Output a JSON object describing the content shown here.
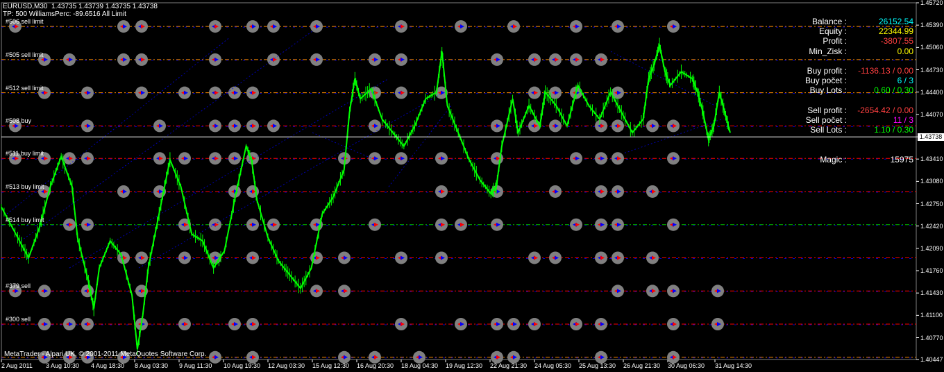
{
  "header": {
    "line1": "EURUSD,M30  1.43735 1.43739 1.43735 1.43738",
    "line2": "TP: 500 WilliamsPerc: -89.6516 All Limit"
  },
  "footer": {
    "copyright": "MetaTrader - Alpari UK, © 2001-2011 MetaQuotes Software Corp."
  },
  "colors": {
    "background": "#000000",
    "price_line": "#00ff00",
    "buy_level": "#ff0000",
    "sell_level": "#0000ff",
    "alt_level": "#ff8c00",
    "green_level": "#00c000",
    "marker": "#808080",
    "label": "#ffffff",
    "value_cyan": "#00ffff",
    "value_yellow": "#ffff00",
    "value_red": "#ff4040",
    "value_magenta": "#ff00ff",
    "value_green": "#00ff00"
  },
  "panel": [
    {
      "label": "Balance :",
      "value": "26152.54",
      "color": "#00ffff"
    },
    {
      "label": "Equity :",
      "value": "22344.99",
      "color": "#ffff00"
    },
    {
      "label": "Profit :",
      "value": "-3807.55",
      "color": "#ff4040"
    },
    {
      "label": "Min_Zisk :",
      "value": "0.00",
      "color": "#ffff00"
    },
    {
      "label": "",
      "value": "",
      "color": "#ffffff"
    },
    {
      "label": "Buy profit :",
      "value": "-1136.13 / 0.00",
      "color": "#ff4040"
    },
    {
      "label": "Buy počet :",
      "value": "6 / 3",
      "color": "#00ffff"
    },
    {
      "label": "Buy Lots :",
      "value": "0.60 / 0.30",
      "color": "#00ff00"
    },
    {
      "label": "",
      "value": "",
      "color": "#ffffff"
    },
    {
      "label": "Sell profit :",
      "value": "-2654.42 / 0.00",
      "color": "#ff4040"
    },
    {
      "label": "Sell počet :",
      "value": "11 / 3",
      "color": "#ff00ff"
    },
    {
      "label": "Sell Lots :",
      "value": "1.10 / 0.30",
      "color": "#00ff00"
    },
    {
      "label": "",
      "value": "",
      "color": "#ffffff"
    },
    {
      "label": "",
      "value": "",
      "color": "#ffffff"
    },
    {
      "label": "Magic :",
      "value": "15975",
      "color": "#ffffff"
    }
  ],
  "chart_data": {
    "type": "line",
    "symbol": "EURUSD",
    "timeframe": "M30",
    "current_price": 1.43738,
    "current_price_label": "1.43738",
    "ylim": [
      1.40447,
      1.4572
    ],
    "y_ticks": [
      "1.45720",
      "1.45390",
      "1.45060",
      "1.44730",
      "1.44400",
      "1.44070",
      "1.43738",
      "1.43410",
      "1.43080",
      "1.42750",
      "1.42420",
      "1.42090",
      "1.41760",
      "1.41430",
      "1.41100",
      "1.40770",
      "1.40447"
    ],
    "x_ticks": [
      "2 Aug 2011",
      "3 Aug 10:30",
      "4 Aug 18:30",
      "8 Aug 03:30",
      "9 Aug 11:30",
      "10 Aug 19:30",
      "12 Aug 03:30",
      "15 Aug 12:30",
      "16 Aug 20:30",
      "18 Aug 04:30",
      "19 Aug 12:30",
      "22 Aug 21:30",
      "24 Aug 05:30",
      "25 Aug 13:30",
      "26 Aug 21:30",
      "30 Aug 06:30",
      "31 Aug 14:30"
    ],
    "levels": [
      {
        "label": "#506 sell limit",
        "price": 1.4537,
        "style": "sell"
      },
      {
        "label": "#505 sell limit",
        "price": 1.4488,
        "style": "sell"
      },
      {
        "label": "#512 sell limit",
        "price": 1.4439,
        "style": "sell"
      },
      {
        "label": "#508 buy",
        "price": 1.439,
        "style": "buy"
      },
      {
        "label": "#511 buy limit",
        "price": 1.4342,
        "style": "buy"
      },
      {
        "label": "#513 buy limit",
        "price": 1.4293,
        "style": "buy"
      },
      {
        "label": "#514 buy limit",
        "price": 1.4244,
        "style": "green"
      },
      {
        "label": "",
        "price": 1.4195,
        "style": "buy"
      },
      {
        "label": "#379 sell",
        "price": 1.4146,
        "style": "buy"
      },
      {
        "label": "#300 sell",
        "price": 1.4097,
        "style": "buy"
      },
      {
        "label": "",
        "price": 1.4048,
        "style": "sell"
      }
    ],
    "price_path": [
      [
        0,
        1.427
      ],
      [
        3,
        1.4225
      ],
      [
        5,
        1.4195
      ],
      [
        7,
        1.424
      ],
      [
        9,
        1.43
      ],
      [
        11,
        1.4345
      ],
      [
        13,
        1.43
      ],
      [
        14,
        1.4225
      ],
      [
        16,
        1.416
      ],
      [
        17,
        1.412
      ],
      [
        18,
        1.418
      ],
      [
        20,
        1.422
      ],
      [
        22,
        1.42
      ],
      [
        24,
        1.414
      ],
      [
        25,
        1.406
      ],
      [
        26,
        1.411
      ],
      [
        27,
        1.418
      ],
      [
        29,
        1.426
      ],
      [
        31,
        1.434
      ],
      [
        33,
        1.43
      ],
      [
        35,
        1.423
      ],
      [
        37,
        1.422
      ],
      [
        39,
        1.418
      ],
      [
        41,
        1.4205
      ],
      [
        43,
        1.4285
      ],
      [
        45,
        1.436
      ],
      [
        46,
        1.434
      ],
      [
        47,
        1.428
      ],
      [
        49,
        1.4225
      ],
      [
        51,
        1.419
      ],
      [
        53,
        1.417
      ],
      [
        55,
        1.415
      ],
      [
        57,
        1.418
      ],
      [
        59,
        1.426
      ],
      [
        61,
        1.4285
      ],
      [
        63,
        1.4325
      ],
      [
        64,
        1.441
      ],
      [
        65,
        1.446
      ],
      [
        66,
        1.443
      ],
      [
        68,
        1.4445
      ],
      [
        70,
        1.44
      ],
      [
        72,
        1.438
      ],
      [
        74,
        1.436
      ],
      [
        76,
        1.439
      ],
      [
        78,
        1.443
      ],
      [
        80,
        1.444
      ],
      [
        81,
        1.45
      ],
      [
        82,
        1.442
      ],
      [
        84,
        1.438
      ],
      [
        86,
        1.434
      ],
      [
        88,
        1.431
      ],
      [
        90,
        1.429
      ],
      [
        91,
        1.43
      ],
      [
        92,
        1.436
      ],
      [
        94,
        1.443
      ],
      [
        95,
        1.438
      ],
      [
        97,
        1.442
      ],
      [
        99,
        1.439
      ],
      [
        100,
        1.444
      ],
      [
        102,
        1.442
      ],
      [
        104,
        1.439
      ],
      [
        106,
        1.445
      ],
      [
        108,
        1.442
      ],
      [
        110,
        1.44
      ],
      [
        112,
        1.444
      ],
      [
        114,
        1.441
      ],
      [
        116,
        1.438
      ],
      [
        118,
        1.44
      ],
      [
        119,
        1.446
      ],
      [
        120,
        1.448
      ],
      [
        121,
        1.451
      ],
      [
        122,
        1.447
      ],
      [
        123,
        1.445
      ],
      [
        125,
        1.447
      ],
      [
        127,
        1.446
      ],
      [
        128,
        1.444
      ],
      [
        129,
        1.441
      ],
      [
        130,
        1.437
      ],
      [
        131,
        1.439
      ],
      [
        132,
        1.444
      ],
      [
        133,
        1.441
      ],
      [
        134,
        1.438
      ]
    ]
  }
}
